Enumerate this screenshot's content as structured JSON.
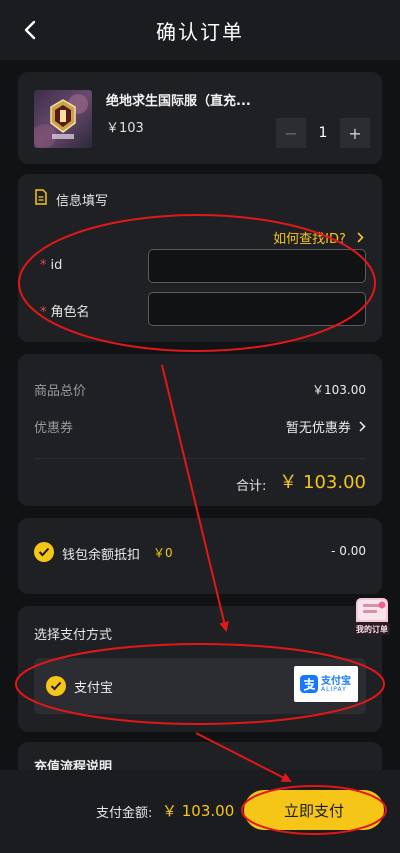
{
  "header": {
    "title": "确认订单"
  },
  "product": {
    "name": "绝地求生国际服（直充...",
    "price": "￥103",
    "quantity": "1",
    "minus_label": "−",
    "plus_label": "+"
  },
  "info": {
    "title": "信息填写",
    "help_link": "如何查找ID?",
    "fields": [
      {
        "label": "id",
        "value": ""
      },
      {
        "label": "角色名",
        "value": ""
      }
    ]
  },
  "summary": {
    "goods_total_label": "商品总价",
    "goods_total_value": "￥103.00",
    "coupon_label": "优惠券",
    "coupon_value": "暂无优惠券",
    "total_label": "合计:",
    "total_value": "￥ 103.00"
  },
  "wallet": {
    "label": "钱包余额抵扣",
    "balance": "￥0",
    "deduction": "- 0.00"
  },
  "payment": {
    "title": "选择支付方式",
    "method": "支付宝",
    "logo_text": "支付宝",
    "logo_sub": "ALIPAY"
  },
  "process": {
    "title": "充值流程说明"
  },
  "footer": {
    "pay_total_label": "支付金额:",
    "pay_total_value": "￥ 103.00",
    "pay_button": "立即支付"
  },
  "float_badge": {
    "label": "我的订单"
  },
  "colors": {
    "accent": "#f5c518",
    "annotation": "#e01818",
    "card": "#1f2024",
    "background": "#111214"
  }
}
